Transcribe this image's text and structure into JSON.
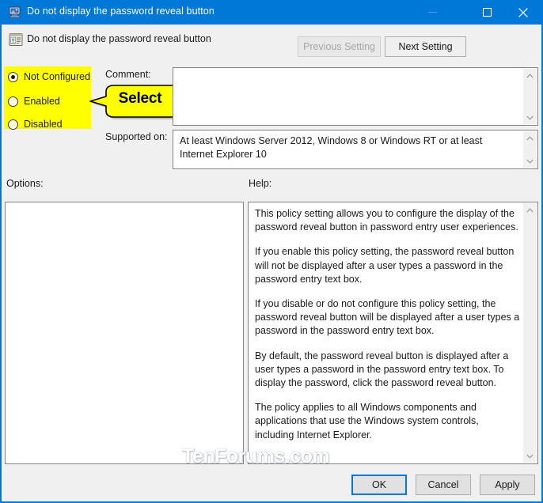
{
  "window": {
    "title": "Do not display the password reveal button",
    "title_icon": "computer-icon",
    "minimize_label": "–",
    "maximize_label": "□",
    "close_label": "✕",
    "accent_color": "#0078d7"
  },
  "header": {
    "icon": "policy-setting-icon",
    "title": "Do not display the password reveal button",
    "previous_setting_label": "Previous Setting",
    "next_setting_label": "Next Setting"
  },
  "state_options": {
    "highlight_color": "#ffff00",
    "items": [
      {
        "label": "Not Configured",
        "selected": true
      },
      {
        "label": "Enabled",
        "selected": false
      },
      {
        "label": "Disabled",
        "selected": false
      }
    ]
  },
  "callout": {
    "text": "Select",
    "fill_color": "#ffff00",
    "border_color": "#000000"
  },
  "comment": {
    "label": "Comment:",
    "value": "",
    "scroll_up_icon": "chevron-up-icon",
    "scroll_down_icon": "chevron-down-icon"
  },
  "supported_on": {
    "label": "Supported on:",
    "value": "At least Windows Server 2012, Windows 8 or Windows RT or at least Internet Explorer 10",
    "scroll_up_icon": "chevron-up-icon",
    "scroll_down_icon": "chevron-down-icon"
  },
  "options": {
    "label": "Options:",
    "value": ""
  },
  "help": {
    "label": "Help:",
    "paragraphs": [
      "This policy setting allows you to configure the display of the password reveal button in password entry user experiences.",
      "If you enable this policy setting, the password reveal button will not be displayed after a user types a password in the password entry text box.",
      "If you disable or do not configure this policy setting, the password reveal button will be displayed after a user types a password in the password entry text box.",
      "By default, the password reveal button is displayed after a user types a password in the password entry text box. To display the password, click the password reveal button.",
      "The policy applies to all Windows components and applications that use the Windows system controls, including Internet Explorer."
    ],
    "scroll_up_icon": "chevron-up-icon",
    "scroll_down_icon": "chevron-down-icon"
  },
  "footer": {
    "ok_label": "OK",
    "cancel_label": "Cancel",
    "apply_label": "Apply"
  },
  "watermark": {
    "text": "TenForums.com"
  }
}
